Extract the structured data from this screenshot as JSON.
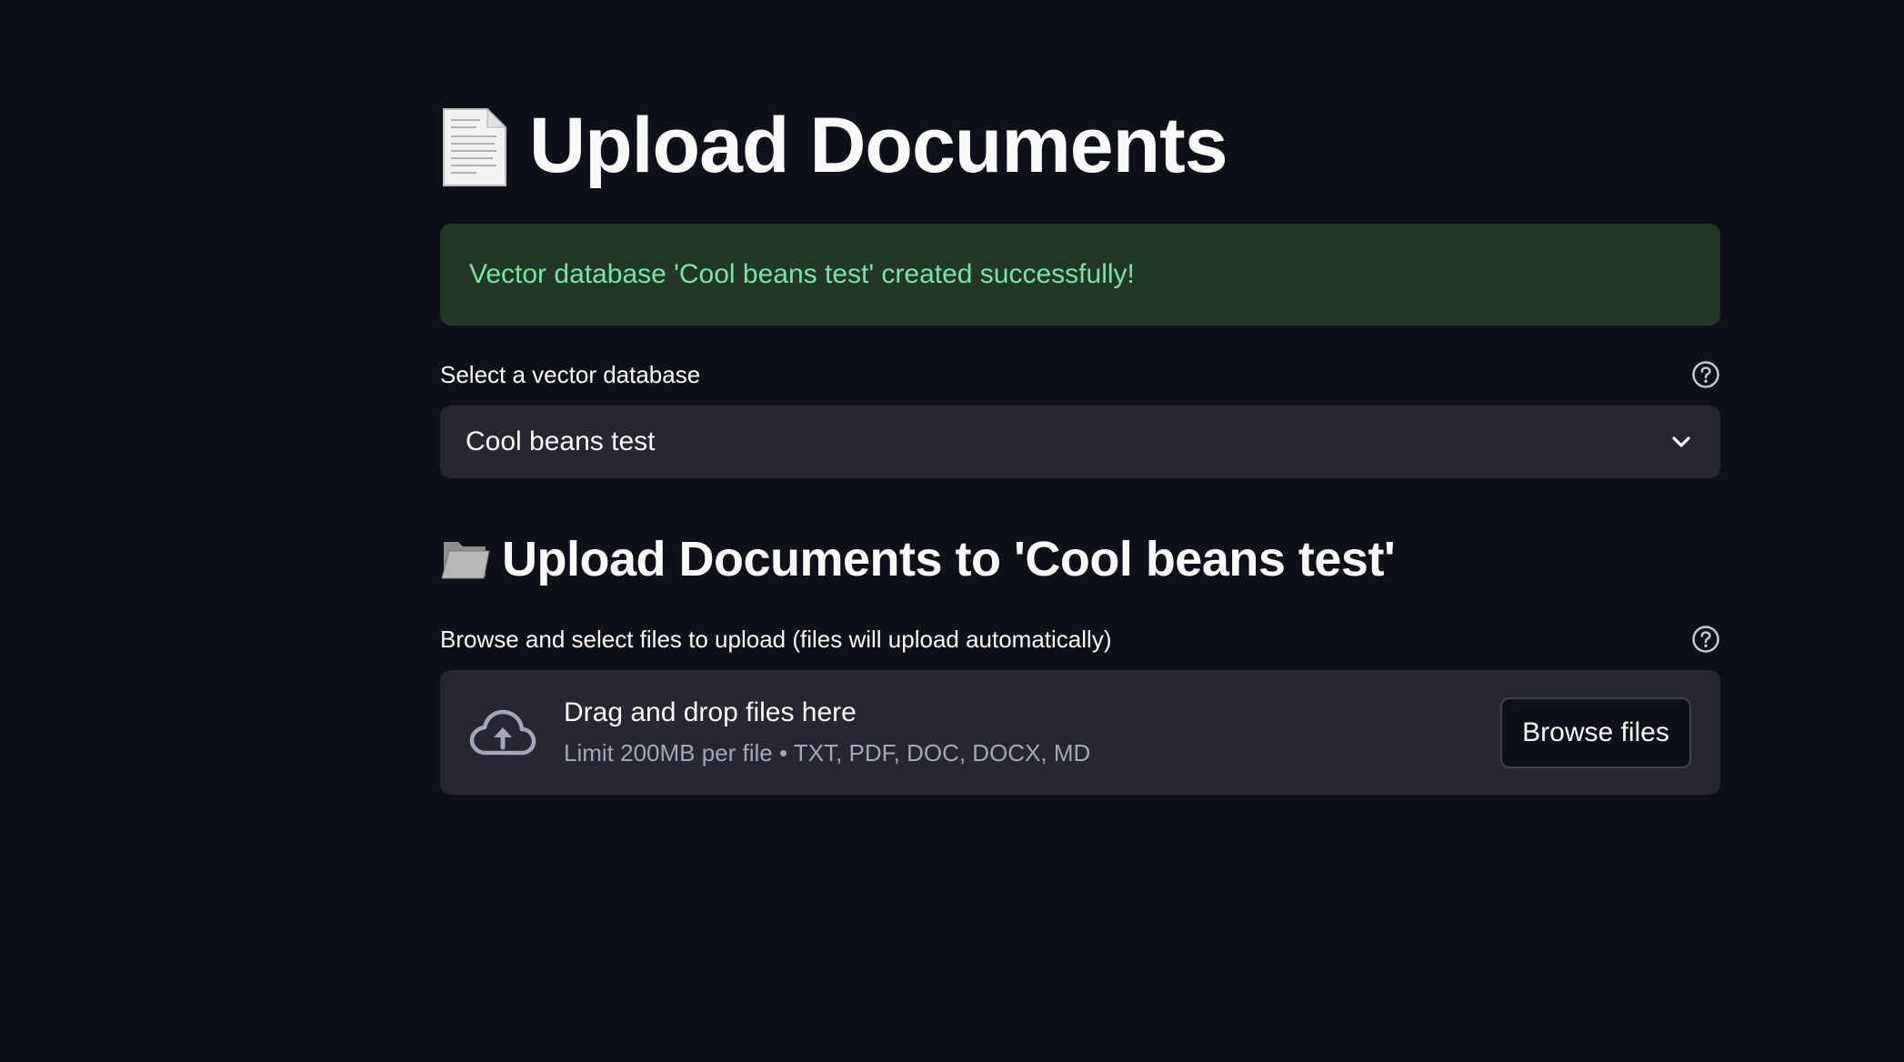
{
  "header": {
    "title": "Upload Documents",
    "title_icon": "page-facing-up-icon"
  },
  "alert": {
    "message": "Vector database 'Cool beans test' created successfully!",
    "color": "#7ee2a0",
    "background": "#213829"
  },
  "db_select": {
    "label": "Select a vector database",
    "value": "Cool beans test",
    "help_icon": "question-circle-icon",
    "dropdown_icon": "chevron-down-icon"
  },
  "upload_section": {
    "title": "Upload Documents to 'Cool beans test'",
    "title_icon": "folder-icon",
    "label": "Browse and select files to upload (files will upload automatically)",
    "help_icon": "question-circle-icon",
    "dropzone": {
      "icon": "cloud-upload-icon",
      "title": "Drag and drop files here",
      "subtitle": "Limit 200MB per file • TXT, PDF, DOC, DOCX, MD",
      "button_label": "Browse files"
    }
  },
  "colors": {
    "background": "#0e1117",
    "widget_background": "#262730"
  }
}
